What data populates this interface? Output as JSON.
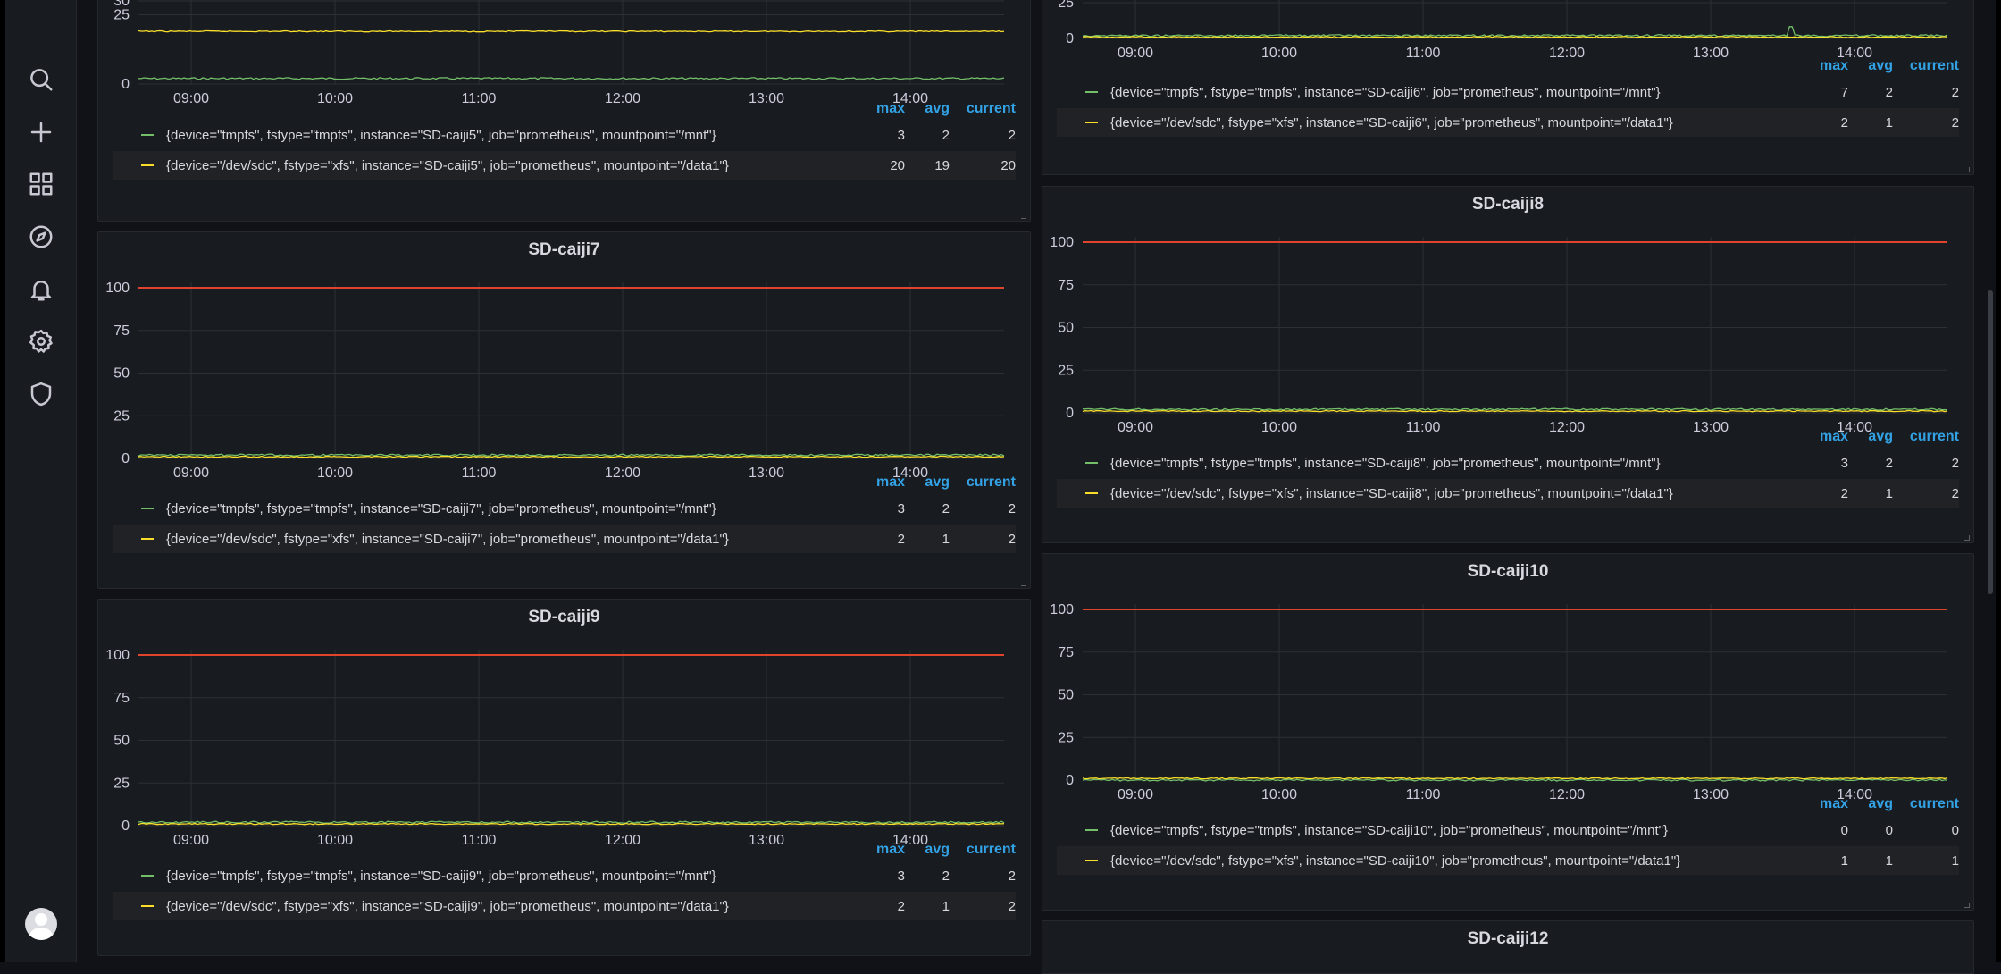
{
  "nav": {
    "icons": [
      "search-icon",
      "plus-icon",
      "dashboards-icon",
      "explore-icon",
      "alerting-icon",
      "settings-icon",
      "shield-icon"
    ],
    "avatar": "user-avatar"
  },
  "colors": {
    "threshold": "#e0442c",
    "series_mnt": "#73bf69",
    "series_data1": "#fade2a",
    "legend_header": "#33a2e5",
    "grid": "#2c2f35"
  },
  "legend_headers": {
    "max": "max",
    "avg": "avg",
    "current": "current"
  },
  "x_ticks": [
    "09:00",
    "10:00",
    "11:00",
    "12:00",
    "13:00",
    "14:00"
  ],
  "panels": [
    {
      "id": "p5",
      "title": "",
      "y_ticks": [
        "30",
        "25",
        "0"
      ],
      "ylim": [
        0,
        30
      ],
      "series": [
        {
          "name": "{device=\"tmpfs\", fstype=\"tmpfs\", instance=\"SD-caiji5\", job=\"prometheus\", mountpoint=\"/mnt\"}",
          "max": "3",
          "avg": "2",
          "current": "2",
          "level": 2,
          "spikes": []
        },
        {
          "name": "{device=\"/dev/sdc\", fstype=\"xfs\", instance=\"SD-caiji5\", job=\"prometheus\", mountpoint=\"/data1\"}",
          "max": "20",
          "avg": "19",
          "current": "20",
          "level": 19,
          "spikes": []
        }
      ],
      "threshold": null
    },
    {
      "id": "p6",
      "title": "",
      "y_ticks": [
        "25",
        "0"
      ],
      "ylim": [
        0,
        25
      ],
      "series": [
        {
          "name": "{device=\"tmpfs\", fstype=\"tmpfs\", instance=\"SD-caiji6\", job=\"prometheus\", mountpoint=\"/mnt\"}",
          "max": "7",
          "avg": "2",
          "current": "2",
          "level": 2,
          "spikes": [
            0.82
          ]
        },
        {
          "name": "{device=\"/dev/sdc\", fstype=\"xfs\", instance=\"SD-caiji6\", job=\"prometheus\", mountpoint=\"/data1\"}",
          "max": "2",
          "avg": "1",
          "current": "2",
          "level": 1,
          "spikes": []
        }
      ],
      "threshold": null
    },
    {
      "id": "p7",
      "title": "SD-caiji7",
      "y_ticks": [
        "100",
        "75",
        "50",
        "25",
        "0"
      ],
      "ylim": [
        0,
        100
      ],
      "series": [
        {
          "name": "{device=\"tmpfs\", fstype=\"tmpfs\", instance=\"SD-caiji7\", job=\"prometheus\", mountpoint=\"/mnt\"}",
          "max": "3",
          "avg": "2",
          "current": "2",
          "level": 2,
          "spikes": []
        },
        {
          "name": "{device=\"/dev/sdc\", fstype=\"xfs\", instance=\"SD-caiji7\", job=\"prometheus\", mountpoint=\"/data1\"}",
          "max": "2",
          "avg": "1",
          "current": "2",
          "level": 1,
          "spikes": []
        }
      ],
      "threshold": 100
    },
    {
      "id": "p8",
      "title": "SD-caiji8",
      "y_ticks": [
        "100",
        "75",
        "50",
        "25",
        "0"
      ],
      "ylim": [
        0,
        100
      ],
      "series": [
        {
          "name": "{device=\"tmpfs\", fstype=\"tmpfs\", instance=\"SD-caiji8\", job=\"prometheus\", mountpoint=\"/mnt\"}",
          "max": "3",
          "avg": "2",
          "current": "2",
          "level": 2,
          "spikes": []
        },
        {
          "name": "{device=\"/dev/sdc\", fstype=\"xfs\", instance=\"SD-caiji8\", job=\"prometheus\", mountpoint=\"/data1\"}",
          "max": "2",
          "avg": "1",
          "current": "2",
          "level": 1,
          "spikes": []
        }
      ],
      "threshold": 100
    },
    {
      "id": "p9",
      "title": "SD-caiji9",
      "y_ticks": [
        "100",
        "75",
        "50",
        "25",
        "0"
      ],
      "ylim": [
        0,
        100
      ],
      "series": [
        {
          "name": "{device=\"tmpfs\", fstype=\"tmpfs\", instance=\"SD-caiji9\", job=\"prometheus\", mountpoint=\"/mnt\"}",
          "max": "3",
          "avg": "2",
          "current": "2",
          "level": 2,
          "spikes": []
        },
        {
          "name": "{device=\"/dev/sdc\", fstype=\"xfs\", instance=\"SD-caiji9\", job=\"prometheus\", mountpoint=\"/data1\"}",
          "max": "2",
          "avg": "1",
          "current": "2",
          "level": 1,
          "spikes": []
        }
      ],
      "threshold": 100
    },
    {
      "id": "p10",
      "title": "SD-caiji10",
      "y_ticks": [
        "100",
        "75",
        "50",
        "25",
        "0"
      ],
      "ylim": [
        0,
        100
      ],
      "series": [
        {
          "name": "{device=\"tmpfs\", fstype=\"tmpfs\", instance=\"SD-caiji10\", job=\"prometheus\", mountpoint=\"/mnt\"}",
          "max": "0",
          "avg": "0",
          "current": "0",
          "level": 0,
          "spikes": []
        },
        {
          "name": "{device=\"/dev/sdc\", fstype=\"xfs\", instance=\"SD-caiji10\", job=\"prometheus\", mountpoint=\"/data1\"}",
          "max": "1",
          "avg": "1",
          "current": "1",
          "level": 1,
          "spikes": []
        }
      ],
      "threshold": 100
    },
    {
      "id": "p12",
      "title": "SD-caiji12",
      "y_ticks": [],
      "ylim": [
        0,
        100
      ],
      "series": [],
      "threshold": null
    }
  ]
}
